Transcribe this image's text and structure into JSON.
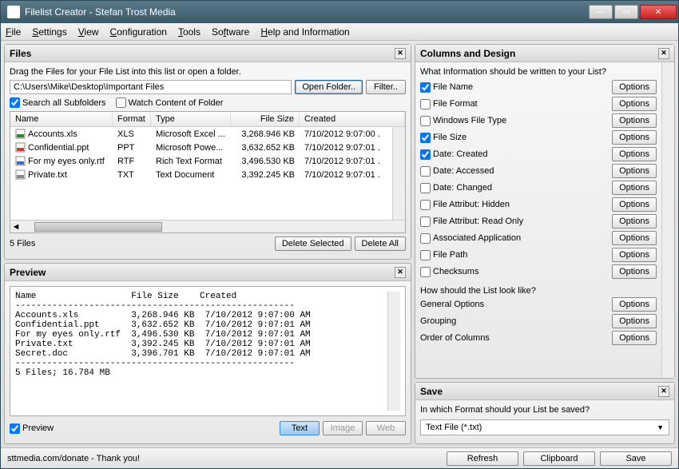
{
  "title": "Filelist Creator - Stefan Trost Media",
  "menu": [
    "File",
    "Settings",
    "View",
    "Configuration",
    "Tools",
    "Software",
    "Help and Information"
  ],
  "files": {
    "title": "Files",
    "hint": "Drag the Files for your File List into this list or open a folder.",
    "path": "C:\\Users\\Mike\\Desktop\\Important Files",
    "open_folder": "Open Folder..",
    "filter": "Filter..",
    "search_sub": "Search all Subfolders",
    "watch": "Watch Content of Folder",
    "cols": {
      "name": "Name",
      "format": "Format",
      "type": "Type",
      "size": "File Size",
      "created": "Created"
    },
    "rows": [
      {
        "icon": "xls",
        "name": "Accounts.xls",
        "fmt": "XLS",
        "type": "Microsoft Excel ...",
        "size": "3,268.946 KB",
        "created": "7/10/2012 9:07:00 ..."
      },
      {
        "icon": "ppt",
        "name": "Confidential.ppt",
        "fmt": "PPT",
        "type": "Microsoft Powe...",
        "size": "3,632.652 KB",
        "created": "7/10/2012 9:07:01 ..."
      },
      {
        "icon": "rtf",
        "name": "For my eyes only.rtf",
        "fmt": "RTF",
        "type": "Rich Text Format",
        "size": "3,496.530 KB",
        "created": "7/10/2012 9:07:01 ..."
      },
      {
        "icon": "txt",
        "name": "Private.txt",
        "fmt": "TXT",
        "type": "Text Document",
        "size": "3,392.245 KB",
        "created": "7/10/2012 9:07:01 ..."
      }
    ],
    "count": "5 Files",
    "delete_sel": "Delete Selected",
    "delete_all": "Delete All"
  },
  "preview": {
    "title": "Preview",
    "text": "Name                  File Size    Created\n-----------------------------------------------------\nAccounts.xls          3,268.946 KB  7/10/2012 9:07:00 AM\nConfidential.ppt      3,632.652 KB  7/10/2012 9:07:01 AM\nFor my eyes only.rtf  3,496.530 KB  7/10/2012 9:07:01 AM\nPrivate.txt           3,392.245 KB  7/10/2012 9:07:01 AM\nSecret.doc            3,396.701 KB  7/10/2012 9:07:01 AM\n-----------------------------------------------------\n5 Files; 16.784 MB",
    "chk": "Preview",
    "tabs": {
      "text": "Text",
      "image": "Image",
      "web": "Web"
    }
  },
  "cd": {
    "title": "Columns and Design",
    "q1": "What Information should be written to your List?",
    "opts": "Options",
    "items": [
      {
        "label": "File Name",
        "checked": true
      },
      {
        "label": "File Format",
        "checked": false
      },
      {
        "label": "Windows File Type",
        "checked": false
      },
      {
        "label": "File Size",
        "checked": true
      },
      {
        "label": "Date: Created",
        "checked": true
      },
      {
        "label": "Date: Accessed",
        "checked": false
      },
      {
        "label": "Date: Changed",
        "checked": false
      },
      {
        "label": "File Attribut: Hidden",
        "checked": false
      },
      {
        "label": "File Attribut: Read Only",
        "checked": false
      },
      {
        "label": "Associated Application",
        "checked": false
      },
      {
        "label": "File Path",
        "checked": false
      },
      {
        "label": "Checksums",
        "checked": false
      }
    ],
    "q2": "How should the List look like?",
    "look": [
      "General Options",
      "Grouping",
      "Order of Columns"
    ]
  },
  "save": {
    "title": "Save",
    "q": "In which Format should your List be saved?",
    "sel": "Text File (*.txt)"
  },
  "footer": {
    "donate": "sttmedia.com/donate - Thank you!",
    "refresh": "Refresh",
    "clipboard": "Clipboard",
    "save": "Save"
  }
}
